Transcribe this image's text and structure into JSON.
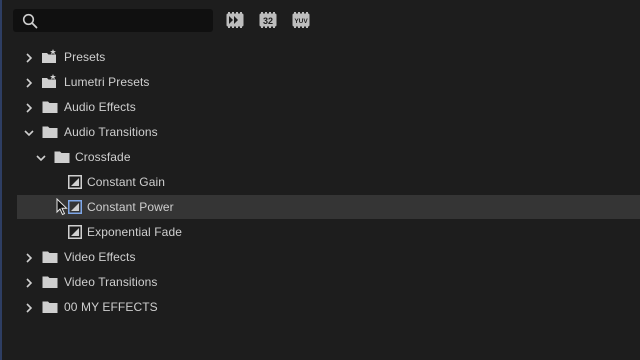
{
  "search": {
    "value": "",
    "placeholder": ""
  },
  "toolbar": {
    "accelerated_icon": "accelerated-effects-icon",
    "bit32_label": "32",
    "yuv_label": "YUV"
  },
  "tree": {
    "presets": "Presets",
    "lumetri_presets": "Lumetri Presets",
    "audio_effects": "Audio Effects",
    "audio_transitions": "Audio Transitions",
    "crossfade": "Crossfade",
    "constant_gain": "Constant Gain",
    "constant_power": "Constant Power",
    "exponential_fade": "Exponential Fade",
    "video_effects": "Video Effects",
    "video_transitions": "Video Transitions",
    "my_effects": "00 MY EFFECTS"
  },
  "colors": {
    "background": "#1d1d1d",
    "selected_row": "#353535",
    "search_field": "#101010",
    "panel_accent": "#2e3e63"
  }
}
